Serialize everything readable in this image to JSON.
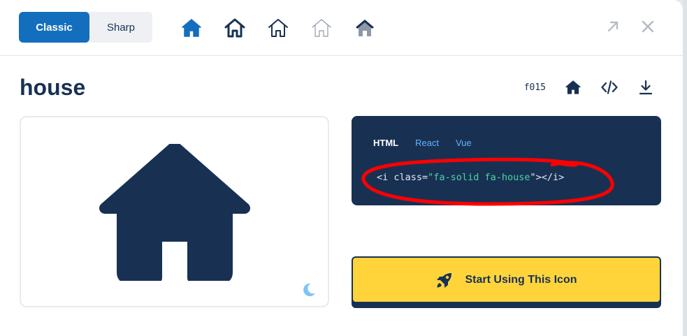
{
  "family_toggle": {
    "classic": "Classic",
    "sharp": "Sharp"
  },
  "style_icons": [
    {
      "name": "solid",
      "color": "#146ebe"
    },
    {
      "name": "regular",
      "color": "#183153"
    },
    {
      "name": "light",
      "color": "#183153"
    },
    {
      "name": "thin",
      "color": "#8e99a8"
    },
    {
      "name": "duotone",
      "color": "#183153"
    }
  ],
  "icon": {
    "title": "house",
    "unicode": "f015"
  },
  "code": {
    "tabs": [
      "HTML",
      "React",
      "Vue"
    ],
    "active_tab": "HTML",
    "line": {
      "open": "<i class=",
      "quote_open": "\"",
      "value": "fa-solid fa-house",
      "close": "\"></i>"
    }
  },
  "cta": {
    "label": "Start Using This Icon"
  },
  "colors": {
    "navy": "#183153",
    "blue": "#146ebe",
    "yellow": "#ffd43b",
    "annotation": "#ff0000"
  }
}
